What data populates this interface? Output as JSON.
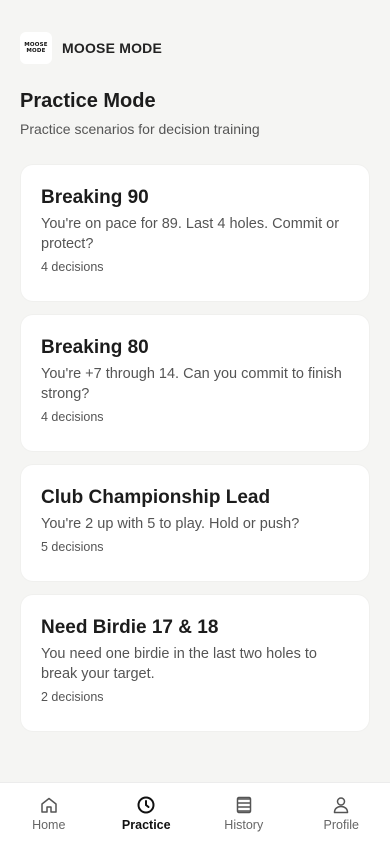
{
  "brand": {
    "logo_line1": "MOOSE",
    "logo_line2": "MODE",
    "name": "MOOSE MODE"
  },
  "page": {
    "title": "Practice Mode",
    "subtitle": "Practice scenarios for decision training"
  },
  "scenarios": [
    {
      "title": "Breaking 90",
      "description": "You're on pace for 89. Last 4 holes. Commit or protect?",
      "decisions": "4 decisions"
    },
    {
      "title": "Breaking 80",
      "description": "You're +7 through 14. Can you commit to finish strong?",
      "decisions": "4 decisions"
    },
    {
      "title": "Club Championship Lead",
      "description": "You're 2 up with 5 to play. Hold or push?",
      "decisions": "5 decisions"
    },
    {
      "title": "Need Birdie 17 & 18",
      "description": "You need one birdie in the last two holes to break your target.",
      "decisions": "2 decisions"
    }
  ],
  "nav": {
    "active": "Practice",
    "items": [
      {
        "label": "Home",
        "icon": "home-icon"
      },
      {
        "label": "Practice",
        "icon": "clock-icon"
      },
      {
        "label": "History",
        "icon": "list-icon"
      },
      {
        "label": "Profile",
        "icon": "person-icon"
      }
    ]
  }
}
